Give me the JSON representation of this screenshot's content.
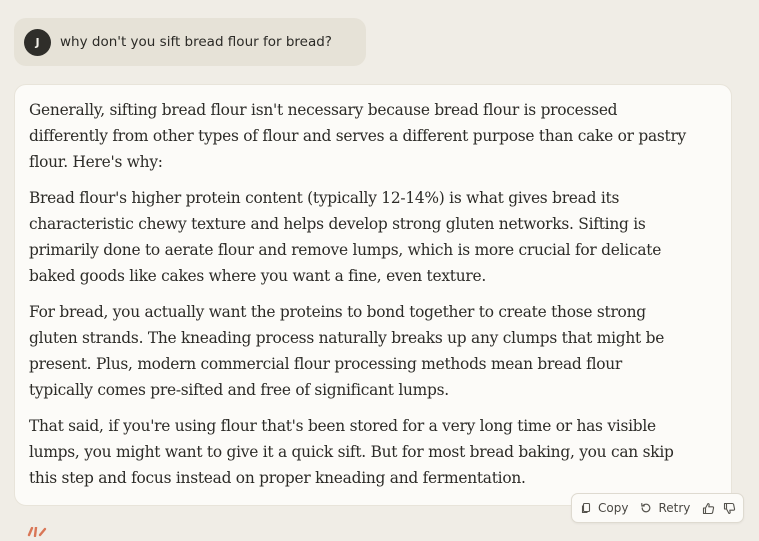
{
  "user_message": {
    "avatar_initial": "J",
    "text": "why don't you sift bread flour for bread?"
  },
  "response": {
    "paragraphs": [
      "Generally, sifting bread flour isn't necessary because bread flour is processed differently from other types of flour and serves a different purpose than cake or pastry flour. Here's why:",
      "Bread flour's higher protein content (typically 12-14%) is what gives bread its characteristic chewy texture and helps develop strong gluten networks. Sifting is primarily done to aerate flour and remove lumps, which is more crucial for delicate baked goods like cakes where you want a fine, even texture.",
      "For bread, you actually want the proteins to bond together to create those strong gluten strands. The kneading process naturally breaks up any clumps that might be present. Plus, modern commercial flour processing methods mean bread flour typically comes pre-sifted and free of significant lumps.",
      "That said, if you're using flour that's been stored for a very long time or has visible lumps, you might want to give it a quick sift. But for most bread baking, you can skip this step and focus instead on proper kneading and fermentation."
    ]
  },
  "actions": {
    "copy_label": "Copy",
    "retry_label": "Retry",
    "icons": [
      "copy-icon",
      "retry-icon",
      "thumbs-up-icon",
      "thumbs-down-icon"
    ]
  },
  "colors": {
    "background": "#f0ede6",
    "user_bubble": "#e6e2d7",
    "card": "#fcfbf8",
    "avatar": "#2f2e2a",
    "brand_accent": "#d97757"
  }
}
